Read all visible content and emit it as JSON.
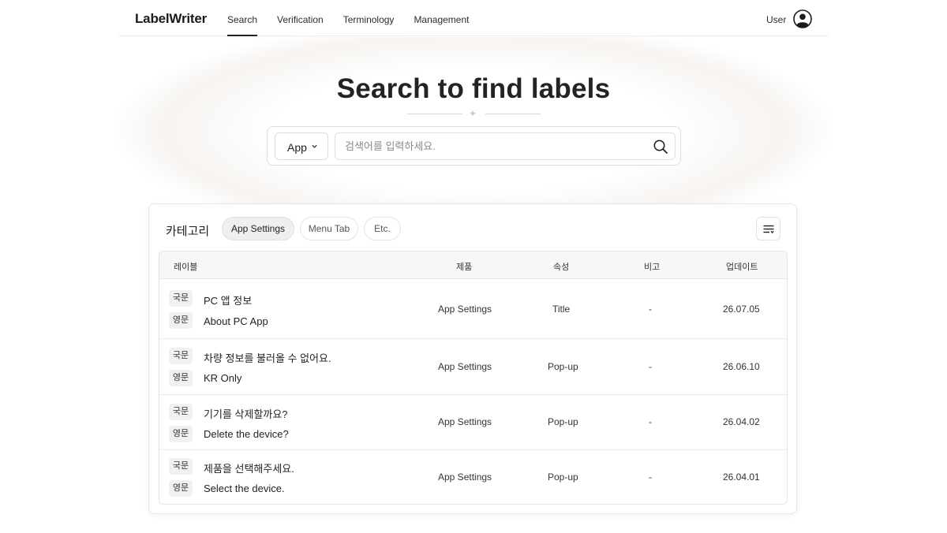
{
  "header": {
    "logo": "LabelWriter",
    "nav": [
      {
        "label": "Search",
        "active": true
      },
      {
        "label": "Verification",
        "active": false
      },
      {
        "label": "Terminology",
        "active": false
      },
      {
        "label": "Management",
        "active": false
      }
    ],
    "user_label": "User",
    "user_icon": "user-circle-icon"
  },
  "hero": {
    "title": "Search to find labels"
  },
  "search": {
    "select_value": "App",
    "placeholder": "검색어를 입력하세요.",
    "value": "",
    "icon": "search-icon"
  },
  "category": {
    "label": "카테고리",
    "chips": [
      {
        "label": "App Settings",
        "active": true
      },
      {
        "label": "Menu Tab",
        "active": false
      },
      {
        "label": "Etc.",
        "active": false
      }
    ],
    "filter_icon": "filter-lines-icon"
  },
  "table": {
    "headers": [
      "레이블",
      "제품",
      "속성",
      "비고",
      "업데이트"
    ],
    "rows": [
      {
        "ko_tag": "국문",
        "ko": "PC 앱 정보",
        "en_tag": "영문",
        "en": "About PC App",
        "product": "App Settings",
        "attr": "Title",
        "note": "-",
        "updated": "26.07.05"
      },
      {
        "ko_tag": "국문",
        "ko": "차량 정보를 불러올 수 없어요.",
        "en_tag": "영문",
        "en": "KR Only",
        "product": "App Settings",
        "attr": "Pop-up",
        "note": "-",
        "updated": "26.06.10"
      },
      {
        "ko_tag": "국문",
        "ko": "기기를 삭제할까요?",
        "en_tag": "영문",
        "en": "Delete the device?",
        "product": "App Settings",
        "attr": "Pop-up",
        "note": "-",
        "updated": "26.04.02"
      },
      {
        "ko_tag": "국문",
        "ko": "제품을 선택해주세요.",
        "en_tag": "영문",
        "en": "Select the device.",
        "product": "App Settings",
        "attr": "Pop-up",
        "note": "-",
        "updated": "26.04.01"
      }
    ]
  },
  "colors": {
    "text": "#1f1f1f",
    "active_chip_bg": "#f1efed",
    "header_row_bg": "#f7f7f7",
    "tag_bg": "#f1f1f1",
    "border": "#e4e4e4"
  }
}
